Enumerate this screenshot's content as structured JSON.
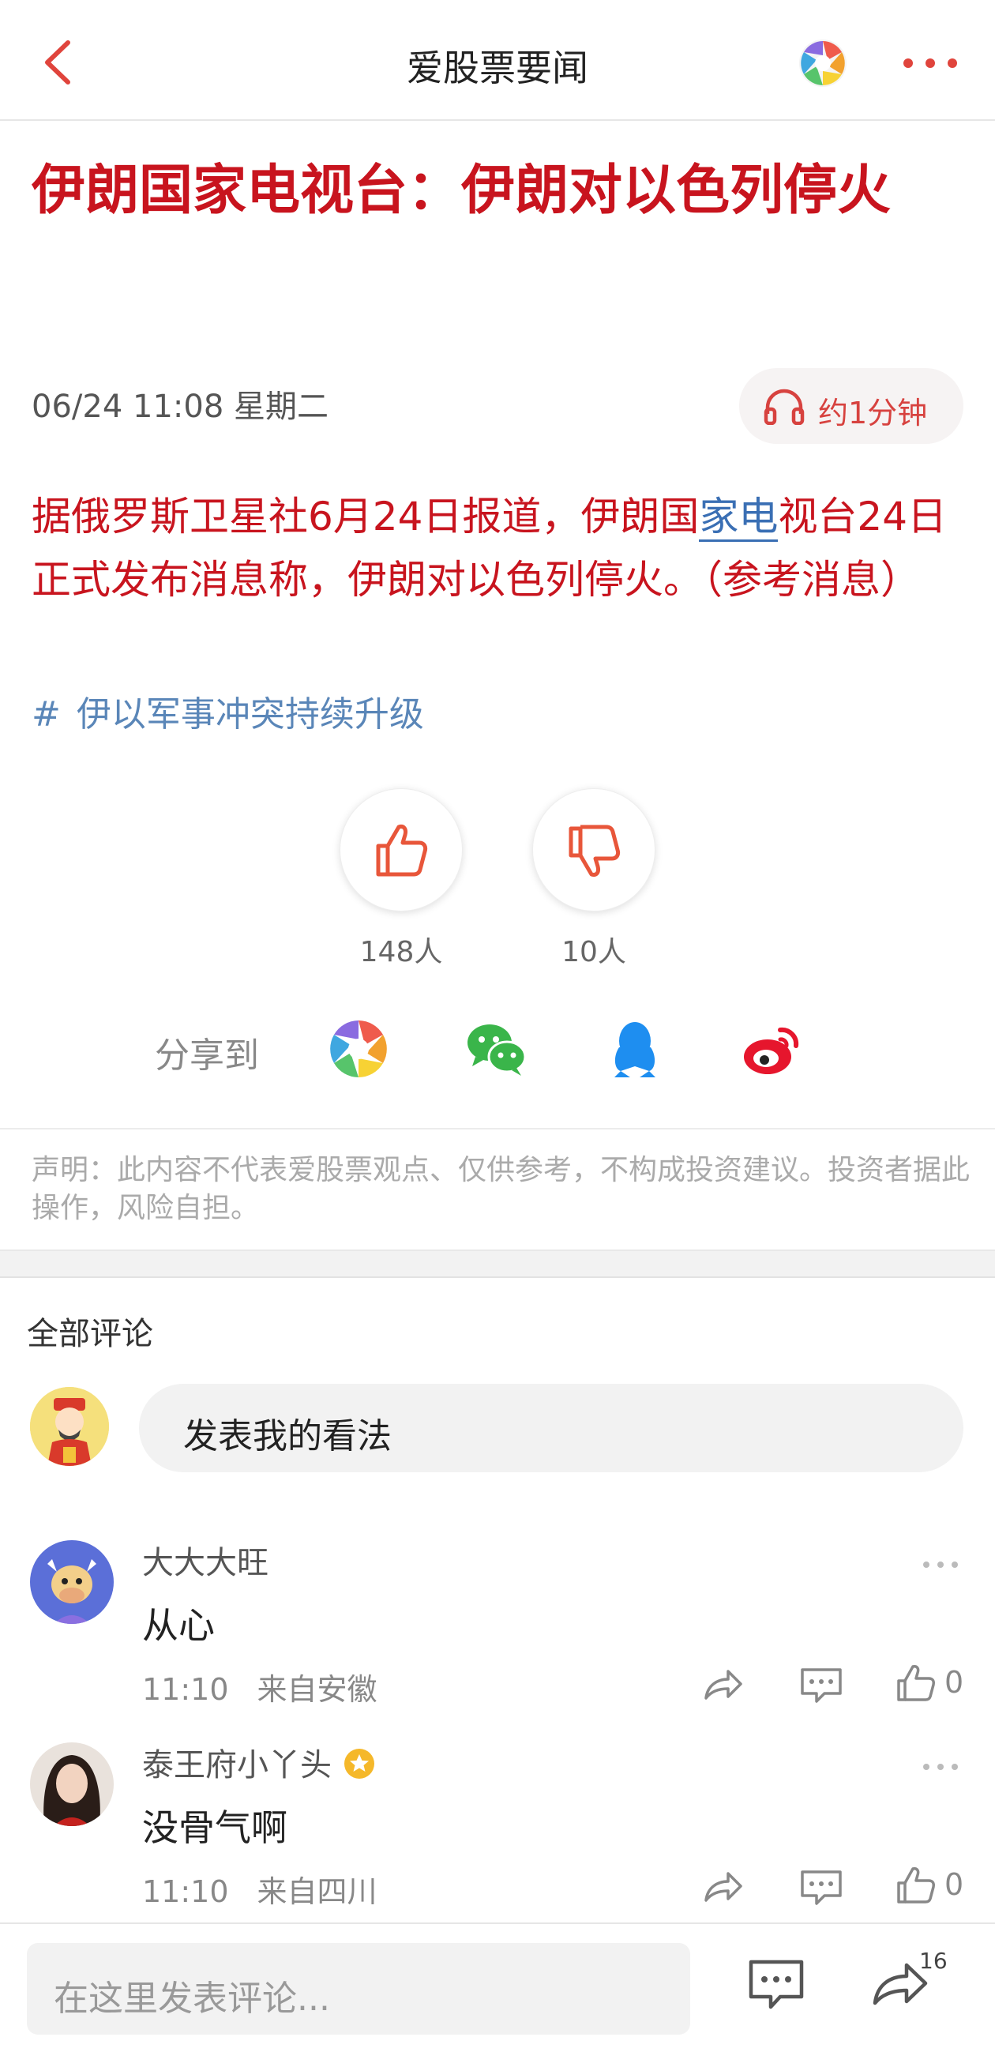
{
  "header": {
    "title": "爱股票要闻",
    "icons": [
      "back-arrow-icon",
      "app-logo-icon",
      "more-dots-icon"
    ]
  },
  "article": {
    "headline": "伊朗国家电视台：伊朗对以色列停火",
    "date": "06/24 11:08 星期二",
    "listen_label": "约1分钟",
    "body_before_link": "据俄罗斯卫星社6月24日报道，伊朗国",
    "body_link": "家电",
    "body_after_link": "视台24日正式发布消息称，伊朗对以色列停火。（参考消息）",
    "hashtag": "伊以军事冲突持续升级",
    "hash_symbol": "#"
  },
  "reactions": {
    "like_count": "148人",
    "dislike_count": "10人"
  },
  "share": {
    "label": "分享到",
    "targets": [
      "aigupiao-icon",
      "wechat-icon",
      "qq-icon",
      "weibo-icon"
    ]
  },
  "disclaimer": "声明：此内容不代表爱股票观点、仅供参考，不构成投资建议。投资者据此操作，风险自担。",
  "comments_section": {
    "title": "全部评论",
    "input_prompt": "发表我的看法",
    "comments": [
      {
        "user": "大大大旺",
        "text": "从心",
        "time": "11:10",
        "location": "来自安徽",
        "likes": "0",
        "verified": false
      },
      {
        "user": "泰王府小丫头",
        "text": "没骨气啊",
        "time": "11:10",
        "location": "来自四川",
        "likes": "0",
        "verified": true
      }
    ]
  },
  "bottom_bar": {
    "placeholder": "在这里发表评论...",
    "share_count": "16"
  },
  "colors": {
    "headline_red": "#c8141e",
    "link_blue": "#3a6fb4",
    "accent_orange": "#e8563a"
  }
}
